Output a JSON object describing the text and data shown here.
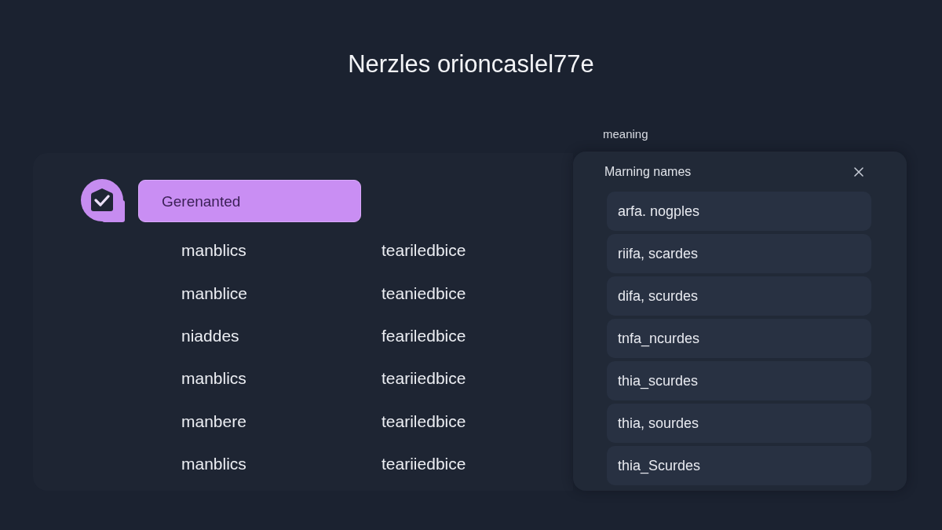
{
  "title": "Nerzles orioncaslel77e",
  "chip": {
    "label": "Gerenanted",
    "selected": true,
    "checked": true
  },
  "table": {
    "rows": [
      {
        "cells": [
          "manblics",
          "teariledbice"
        ]
      },
      {
        "cells": [
          "manblice",
          "teaniedbice"
        ]
      },
      {
        "cells": [
          "niaddes",
          "feariledbice"
        ]
      },
      {
        "cells": [
          "manblics",
          "teariiedbice"
        ]
      },
      {
        "cells": [
          "manbere",
          "teariledbice"
        ]
      },
      {
        "cells": [
          "manblics",
          "teariiedbice"
        ]
      }
    ]
  },
  "side": {
    "label": "meaning",
    "panel": {
      "title": "Marning names",
      "items": [
        "arfa. nogples",
        "riifa, scardes",
        "difa, scurdes",
        "tnfa_ncurdes",
        "thia_scurdes",
        "thia, sourdes",
        "thia_Scurdes"
      ]
    }
  }
}
